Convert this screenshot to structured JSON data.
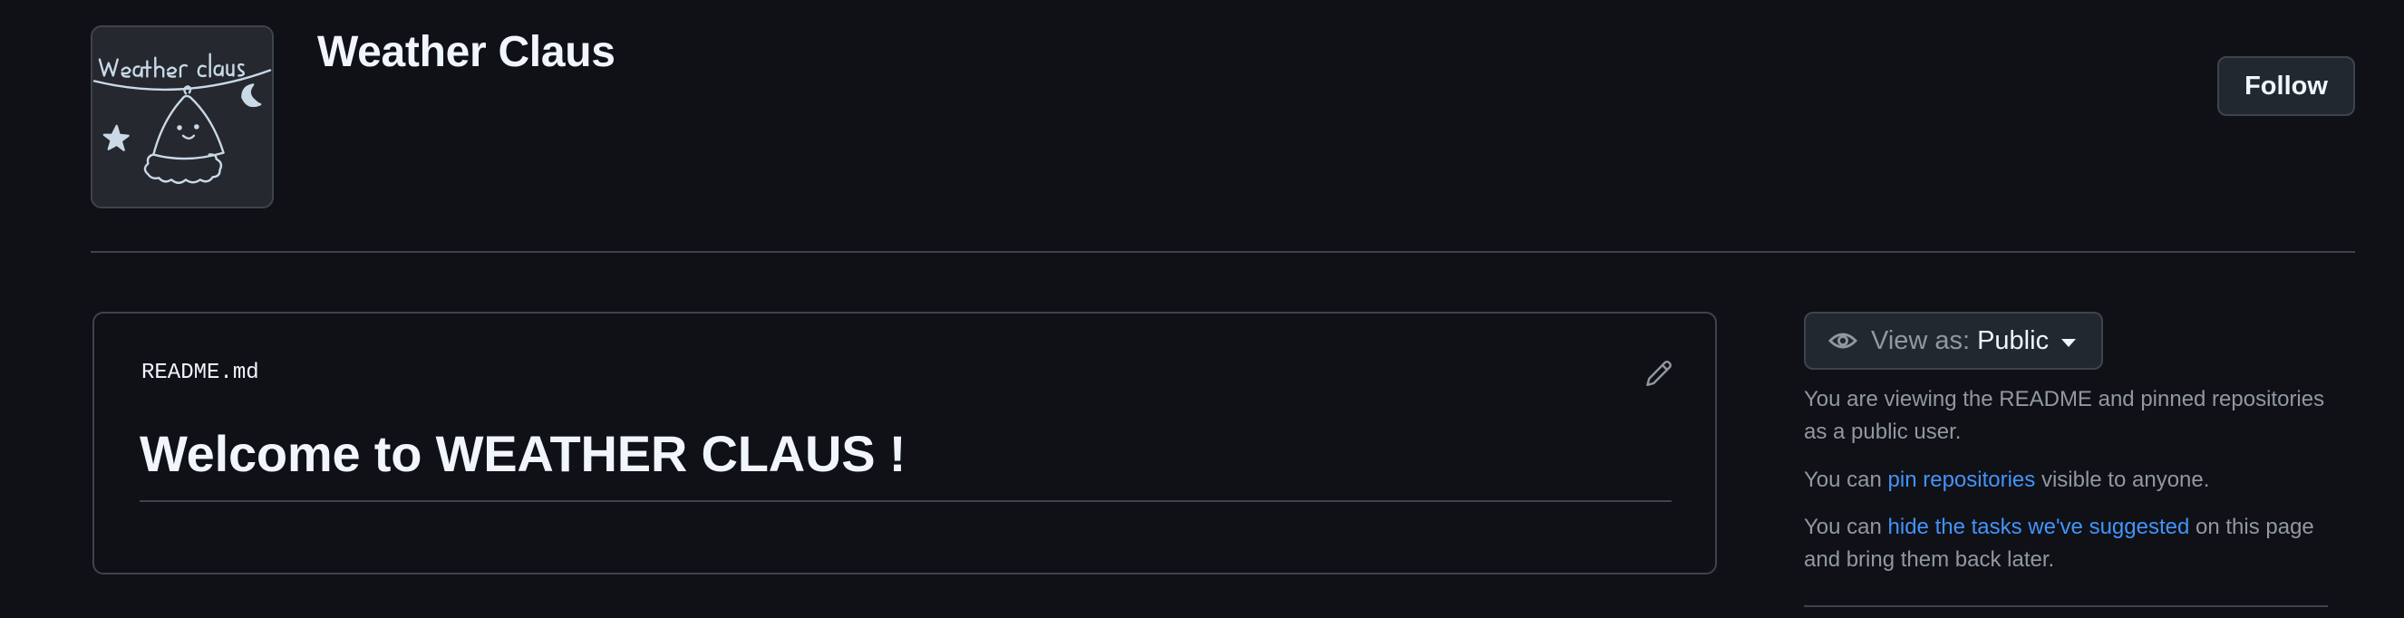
{
  "header": {
    "org_name": "Weather Claus",
    "follow_label": "Follow",
    "avatar": {
      "lettering": "Weather Claus",
      "icon": "weather-claus-logo-icon"
    }
  },
  "readme": {
    "filename": "README.md",
    "edit_icon": "pencil-icon",
    "heading": "Welcome to WEATHER CLAUS !"
  },
  "sidebar": {
    "view_as": {
      "icon": "eye-icon",
      "label": "View as:",
      "value": "Public"
    },
    "paragraph1": "You are viewing the README and pinned repositories as a public user.",
    "paragraph2": {
      "prefix": "You can ",
      "link": "pin repositories",
      "suffix": " visible to anyone."
    },
    "paragraph3": {
      "prefix": "You can ",
      "link": "hide the tasks we've suggested",
      "suffix": " on this page and bring them back later."
    }
  },
  "colors": {
    "background": "#0f1117",
    "border": "#3d444d",
    "button_bg": "#212830",
    "text_primary": "#f0f6fc",
    "text_muted": "#9198a1",
    "link": "#4493f8",
    "avatar_line": "#c9d9e8"
  }
}
